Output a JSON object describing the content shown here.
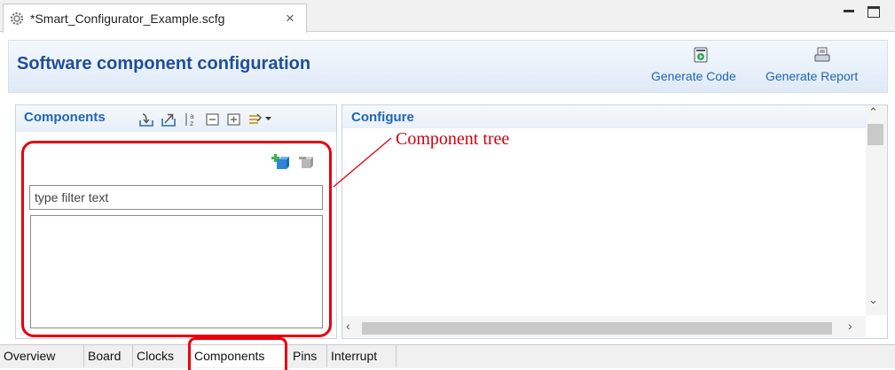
{
  "editor": {
    "tab_title": "*Smart_Configurator_Example.scfg",
    "close_symbol": "×"
  },
  "header": {
    "title": "Software component configuration",
    "generate_code_label": "Generate Code",
    "generate_report_label": "Generate Report"
  },
  "components_pane": {
    "title": "Components",
    "toolbar_icons": [
      "import-icon",
      "export-icon",
      "sort-az-icon",
      "collapse-all-icon",
      "expand-all-icon",
      "view-menu-icon"
    ],
    "filter_placeholder": "type filter text"
  },
  "configure_pane": {
    "title": "Configure"
  },
  "annotation": {
    "label": "Component tree",
    "color": "#e8000f"
  },
  "bottom_tabs": [
    "Overview",
    "Board",
    "Clocks",
    "Components",
    "Pins",
    "Interrupt"
  ],
  "active_tab": "Components",
  "colors": {
    "accent_blue": "#1f66b3",
    "title_blue": "#1f4e9a",
    "highlight_red": "#e8000f"
  }
}
